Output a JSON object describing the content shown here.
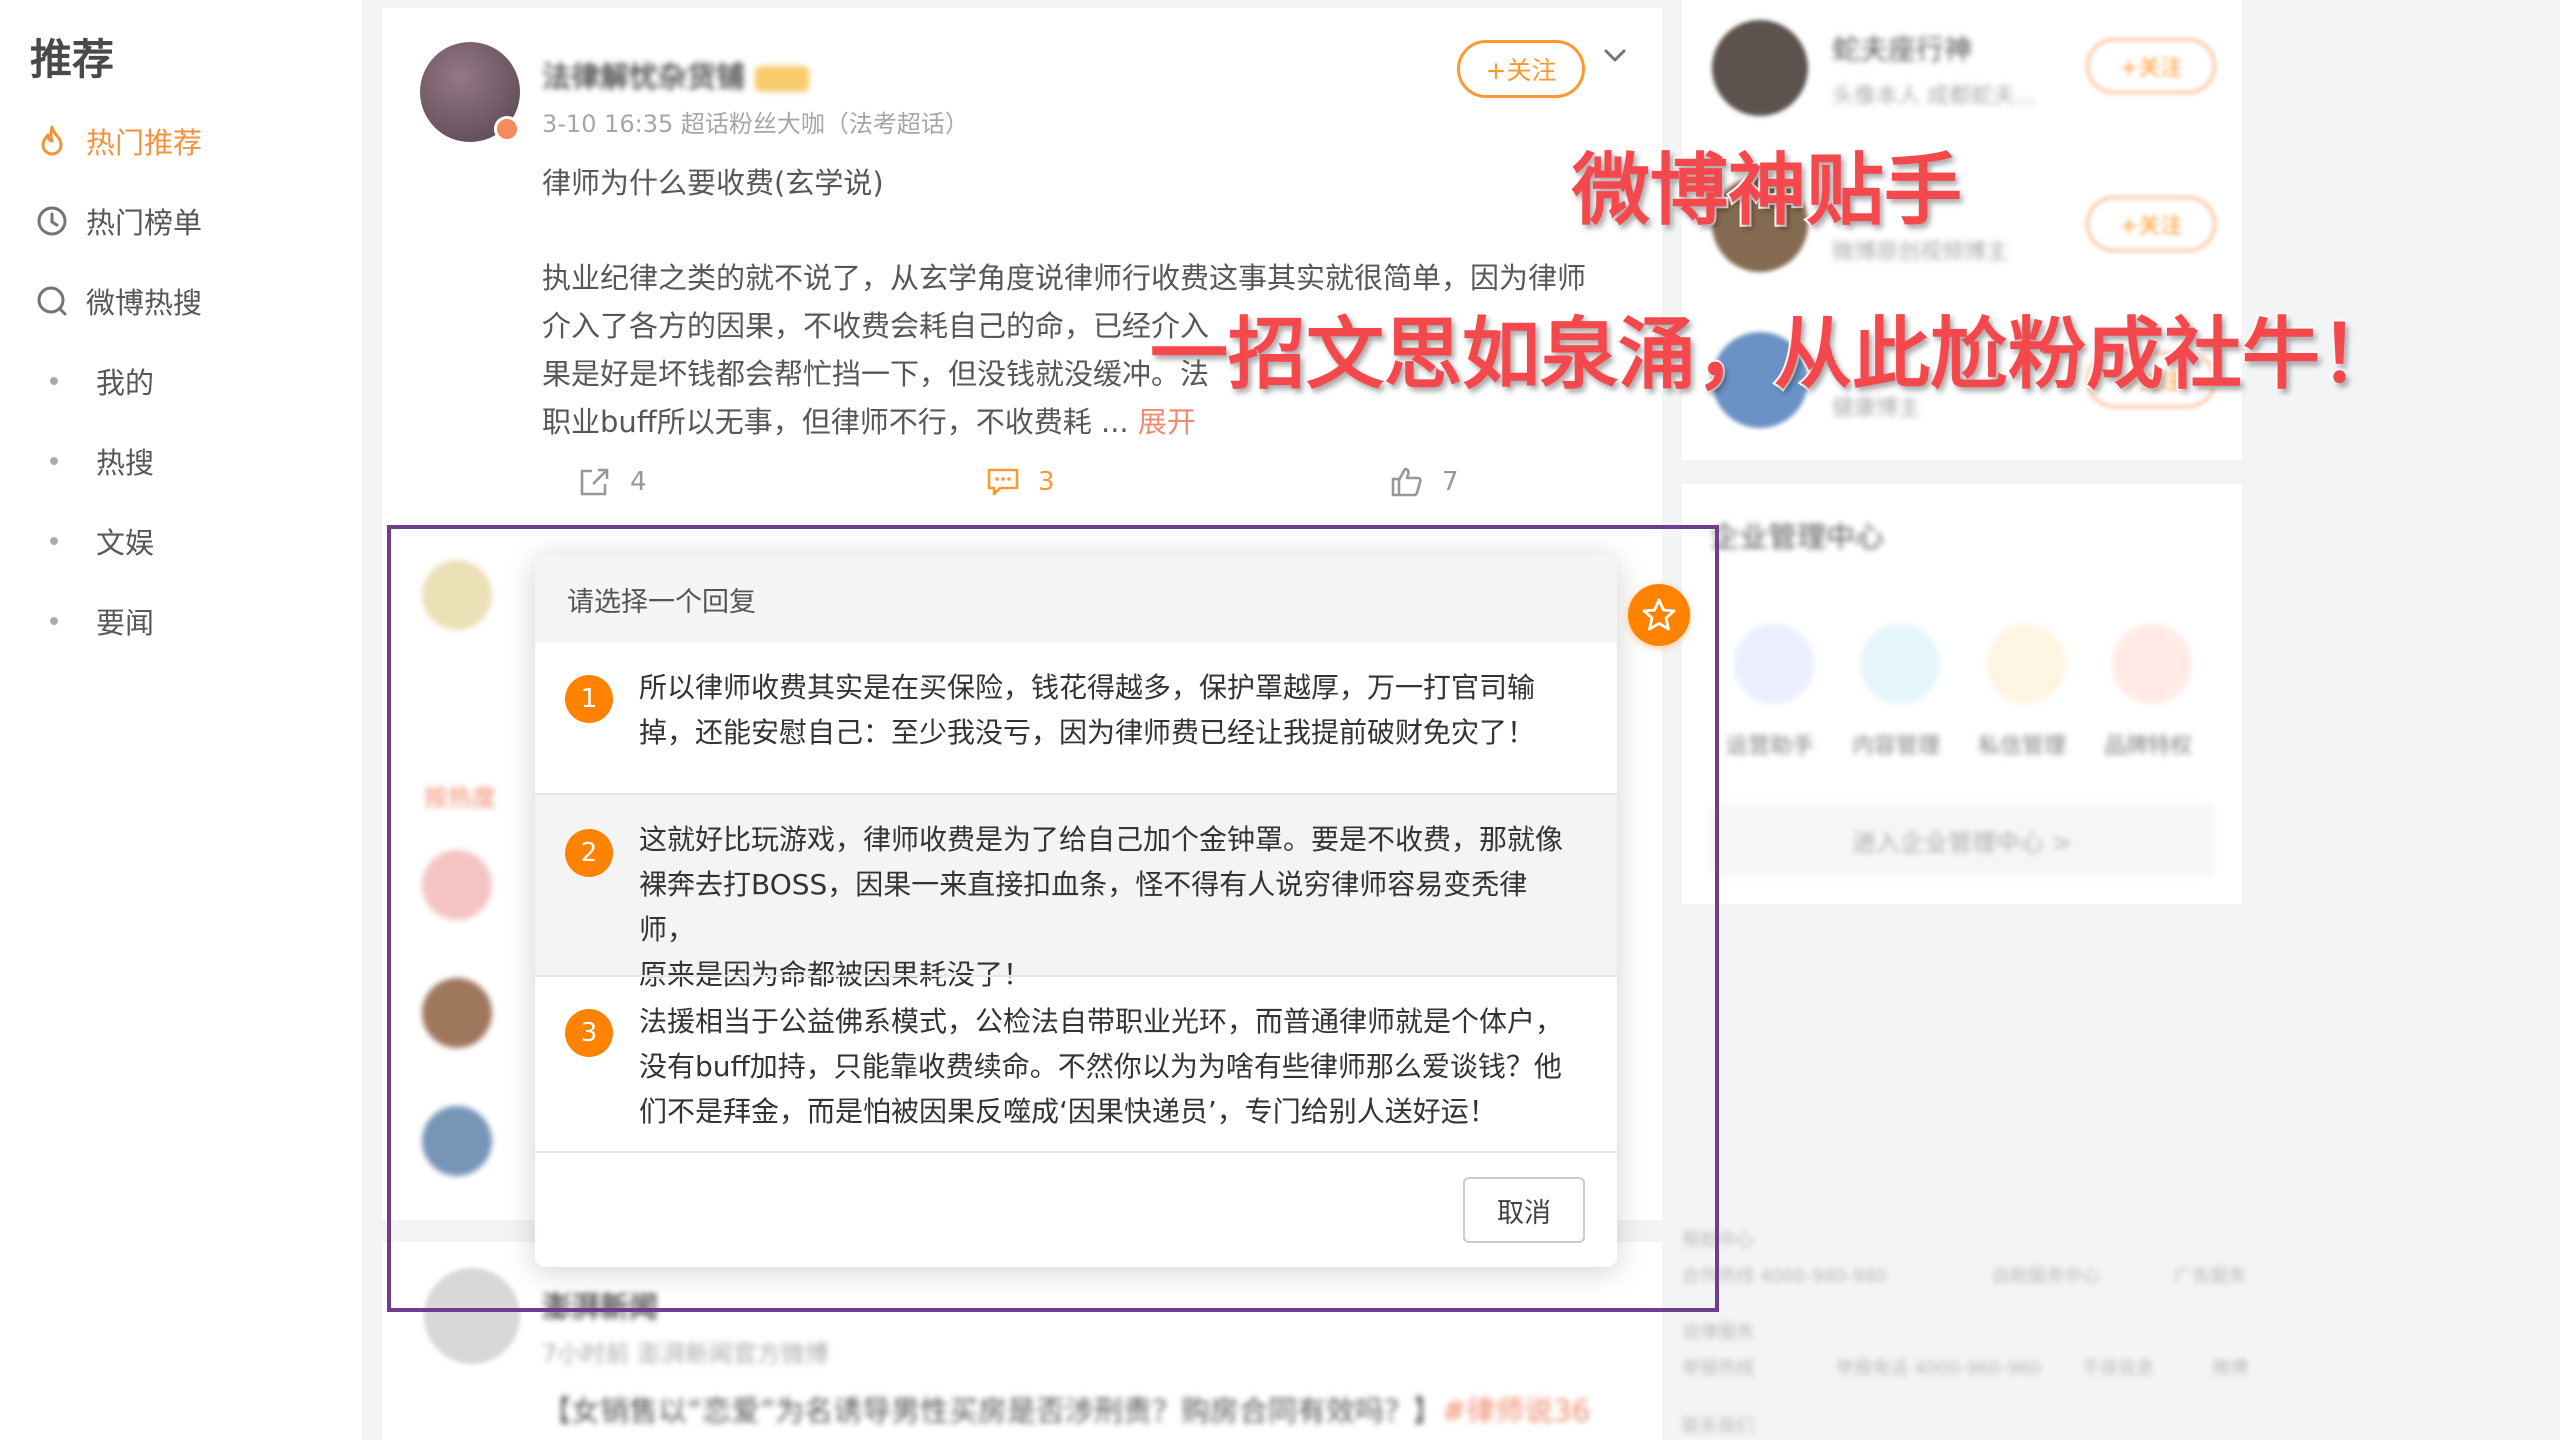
{
  "sidebar": {
    "title": "推荐",
    "items": [
      {
        "label": "热门推荐",
        "icon": "flame-icon"
      },
      {
        "label": "热门榜单",
        "icon": "clock-icon"
      },
      {
        "label": "微博热搜",
        "icon": "search-icon"
      },
      {
        "label": "我的",
        "icon": "dot"
      },
      {
        "label": "热搜",
        "icon": "dot"
      },
      {
        "label": "文娱",
        "icon": "dot"
      },
      {
        "label": "要闻",
        "icon": "dot"
      }
    ]
  },
  "post": {
    "author": "法律解忧杂货铺",
    "meta": "3-10 16:35  超话粉丝大咖（法考超话）",
    "follow_label": "+关注",
    "title": "律师为什么要收费(玄学说)",
    "body_lines": [
      "执业纪律之类的就不说了，从玄学角度说律师行收费这事其实就很简单，因为律师",
      "介入了各方的因果，不收费会耗自己的命，已经介入",
      "果是好是坏钱都会帮忙挡一下，但没钱就没缓冲。法",
      "职业buff所以无事，但律师不行，不收费耗 ..."
    ],
    "expand_label": "展开",
    "share_count": "4",
    "comment_count": "3",
    "like_count": "7"
  },
  "comments": {
    "hot_label": "按热度"
  },
  "post2": {
    "author": "澎湃新闻",
    "meta": "7小时前  澎湃新闻官方微博",
    "body": "【女销售以“恋爱”为名诱导男性买房是否涉刑责？购房合同有效吗？】",
    "tag": "#律师说36"
  },
  "right": {
    "users": [
      {
        "name": "蛇夫座行神",
        "desc": "头像本人 成都蛇夫..."
      },
      {
        "name": "",
        "desc": "微博原创视频博主"
      },
      {
        "name": "",
        "desc": "健康博主"
      }
    ],
    "follow_label": "+关注",
    "enterprise": {
      "title": "企业管理中心",
      "tools": [
        "运营助手",
        "内容管理",
        "私信管理",
        "品牌特权"
      ],
      "button": "进入企业管理中心 >"
    },
    "footer": [
      {
        "a": "帮助中心",
        "b": ""
      },
      {
        "a": "合作热线 4000-980-980",
        "b": "自助服务中心",
        "c": "广告服务"
      },
      {
        "a": "自律服务",
        "b": ""
      },
      {
        "a": "举报热线",
        "b": "举报电话 4000-960-960",
        "c": "不良信息",
        "d": "微博"
      },
      {
        "a": "联系我们",
        "b": ""
      }
    ]
  },
  "dialog": {
    "header": "请选择一个回复",
    "options": [
      {
        "num": "1",
        "lines": [
          "所以律师收费其实是在买保险，钱花得越多，保护罩越厚，万一打官司输",
          "掉，还能安慰自己：至少我没亏，因为律师费已经让我提前破财免灾了！"
        ]
      },
      {
        "num": "2",
        "lines": [
          "这就好比玩游戏，律师收费是为了给自己加个金钟罩。要是不收费，那就像",
          "裸奔去打BOSS，因果一来直接扣血条，怪不得有人说穷律师容易变秃律师，",
          "原来是因为命都被因果耗没了！"
        ]
      },
      {
        "num": "3",
        "lines": [
          "法援相当于公益佛系模式，公检法自带职业光环，而普通律师就是个体户，",
          "没有buff加持，只能靠收费续命。不然你以为为啥有些律师那么爱谈钱？他",
          "们不是拜金，而是怕被因果反噬成‘因果快递员’，专门给别人送好运！"
        ]
      }
    ],
    "cancel_label": "取消"
  },
  "promo": {
    "line1": "微博神贴手",
    "line2": "一招文思如泉涌，从此尬粉成社牛！"
  },
  "colors": {
    "accent": "#ff8200",
    "link": "#eb7350",
    "frame": "#6f3d8c",
    "promo": "#f5484d"
  }
}
